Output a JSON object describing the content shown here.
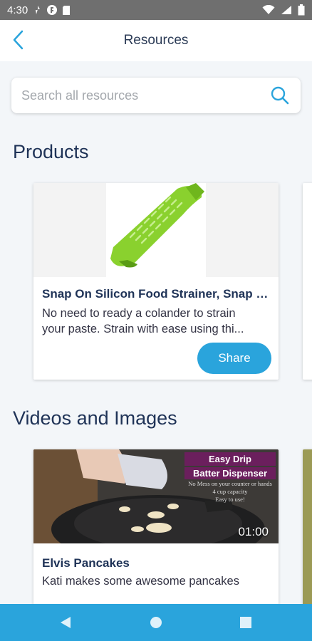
{
  "status_bar": {
    "time": "4:30",
    "left_icons": [
      "pinwheel-icon",
      "circle-badge-icon",
      "sd-card-icon"
    ],
    "right_icons": [
      "wifi-icon",
      "signal-icon",
      "battery-icon"
    ]
  },
  "app_bar": {
    "title": "Resources",
    "back_icon": "chevron-left-icon"
  },
  "search": {
    "placeholder": "Search all resources",
    "value": "",
    "icon": "search-icon"
  },
  "sections": {
    "products": {
      "title": "Products",
      "items": [
        {
          "title": "Snap On Silicon Food Strainer, Snap O...",
          "description_line1": "No need to ready a colander to strain",
          "description_line2": "your paste. Strain with ease using thi...",
          "button_label": "Share",
          "image": "green-silicone-strainer"
        }
      ]
    },
    "videos": {
      "title": "Videos and Images",
      "items": [
        {
          "title": "Elvis Pancakes",
          "description": "Kati makes some awesome pancakes",
          "duration": "01:00",
          "thumbnail_text": {
            "line1": "Easy Drip",
            "line2": "Batter Dispenser",
            "small1": "No Mess on your counter or hands",
            "small2": "4 cup capacity",
            "small3": "Easy to use!"
          }
        }
      ]
    }
  },
  "nav_bar": {
    "back": "triangle-back-icon",
    "home": "circle-home-icon",
    "recents": "square-recents-icon"
  },
  "colors": {
    "accent": "#2aa4dc",
    "heading": "#1f3357",
    "background": "#f3f6f9",
    "status_bar": "#6f6f6f"
  }
}
